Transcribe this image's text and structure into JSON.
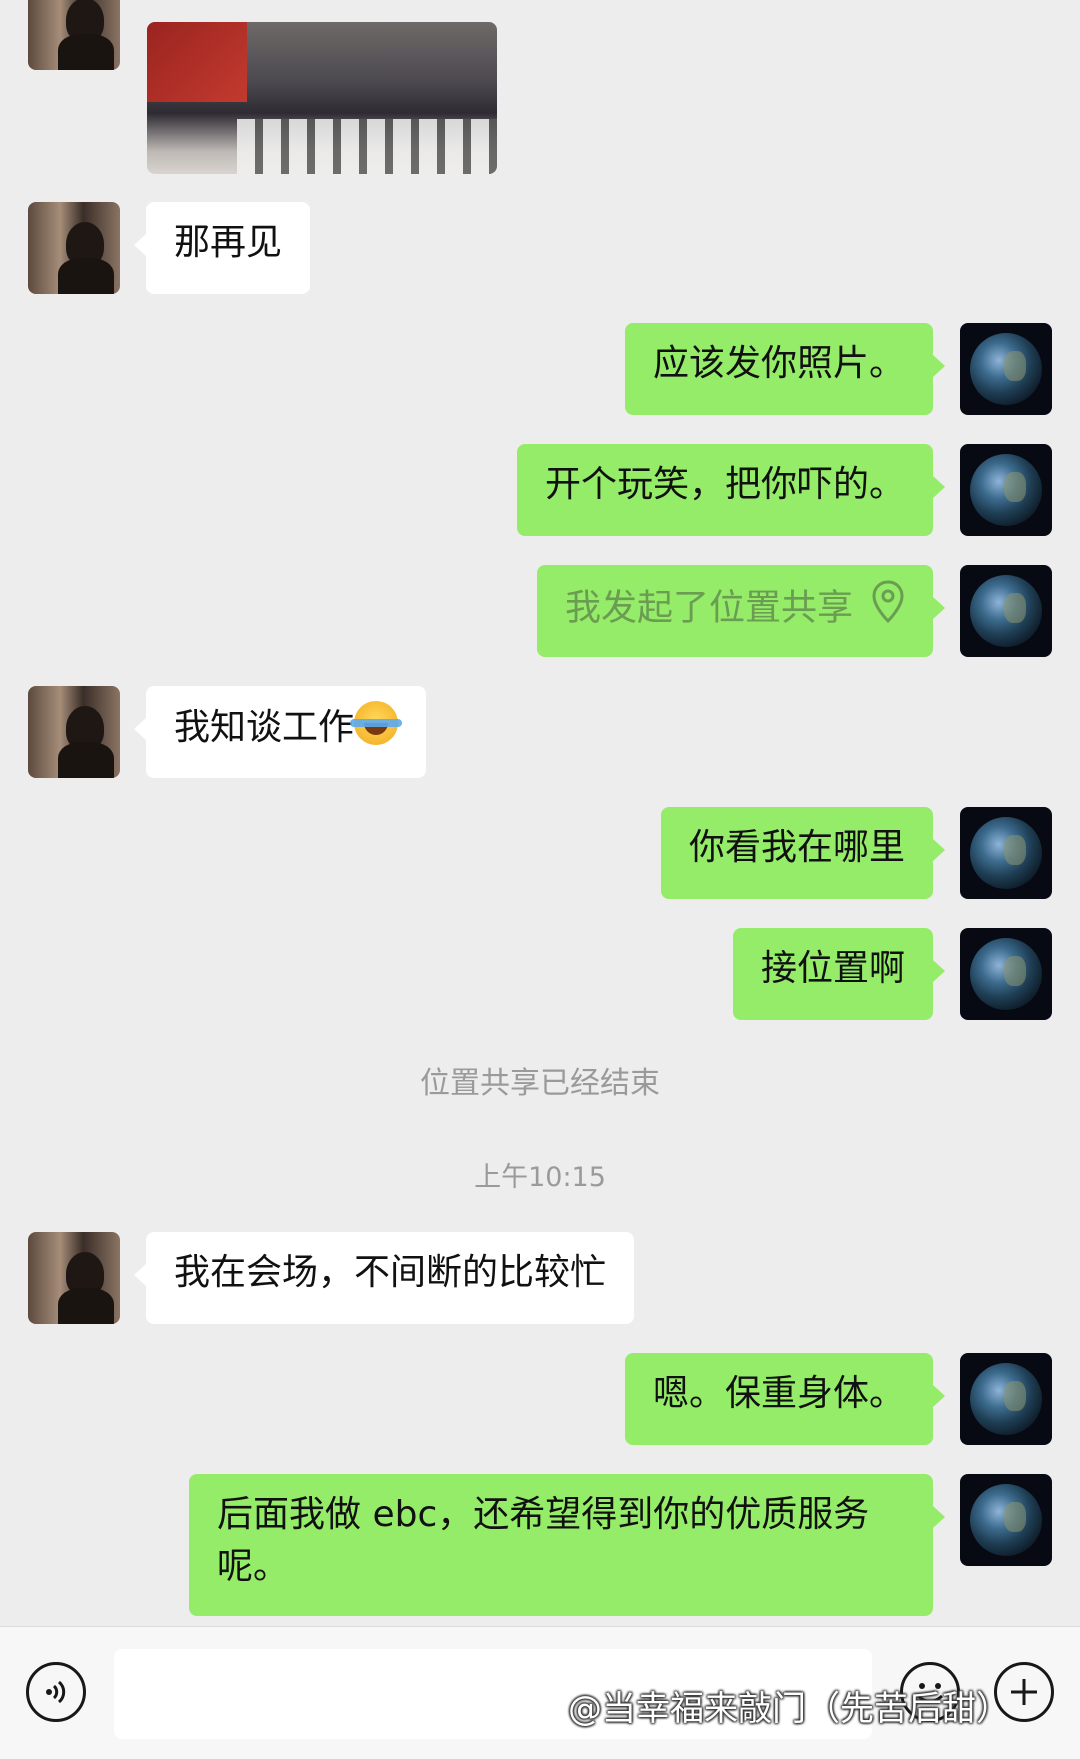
{
  "messages": {
    "m1": "那再见",
    "m2": "应该发你照片。",
    "m3": "开个玩笑，把你吓的。",
    "m4": "我发起了位置共享",
    "m5": "我知谈工作",
    "m6": "你看我在哪里",
    "m7": "接位置啊",
    "m8": "我在会场，不间断的比较忙",
    "m9": "嗯。保重身体。",
    "m10": "后面我做 ebc，还希望得到你的优质服务呢。"
  },
  "system": {
    "location_ended": "位置共享已经结束",
    "timestamp": "上午10:15"
  },
  "input_bar": {
    "watermark": "@当幸福来敲门（先苦后甜）"
  },
  "icons": {
    "voice": "voice-icon",
    "emoji": "emoji-icon",
    "plus": "plus-icon",
    "location": "location-pin-icon"
  },
  "colors": {
    "background": "#ededed",
    "my_bubble": "#95ec69",
    "their_bubble": "#ffffff"
  }
}
